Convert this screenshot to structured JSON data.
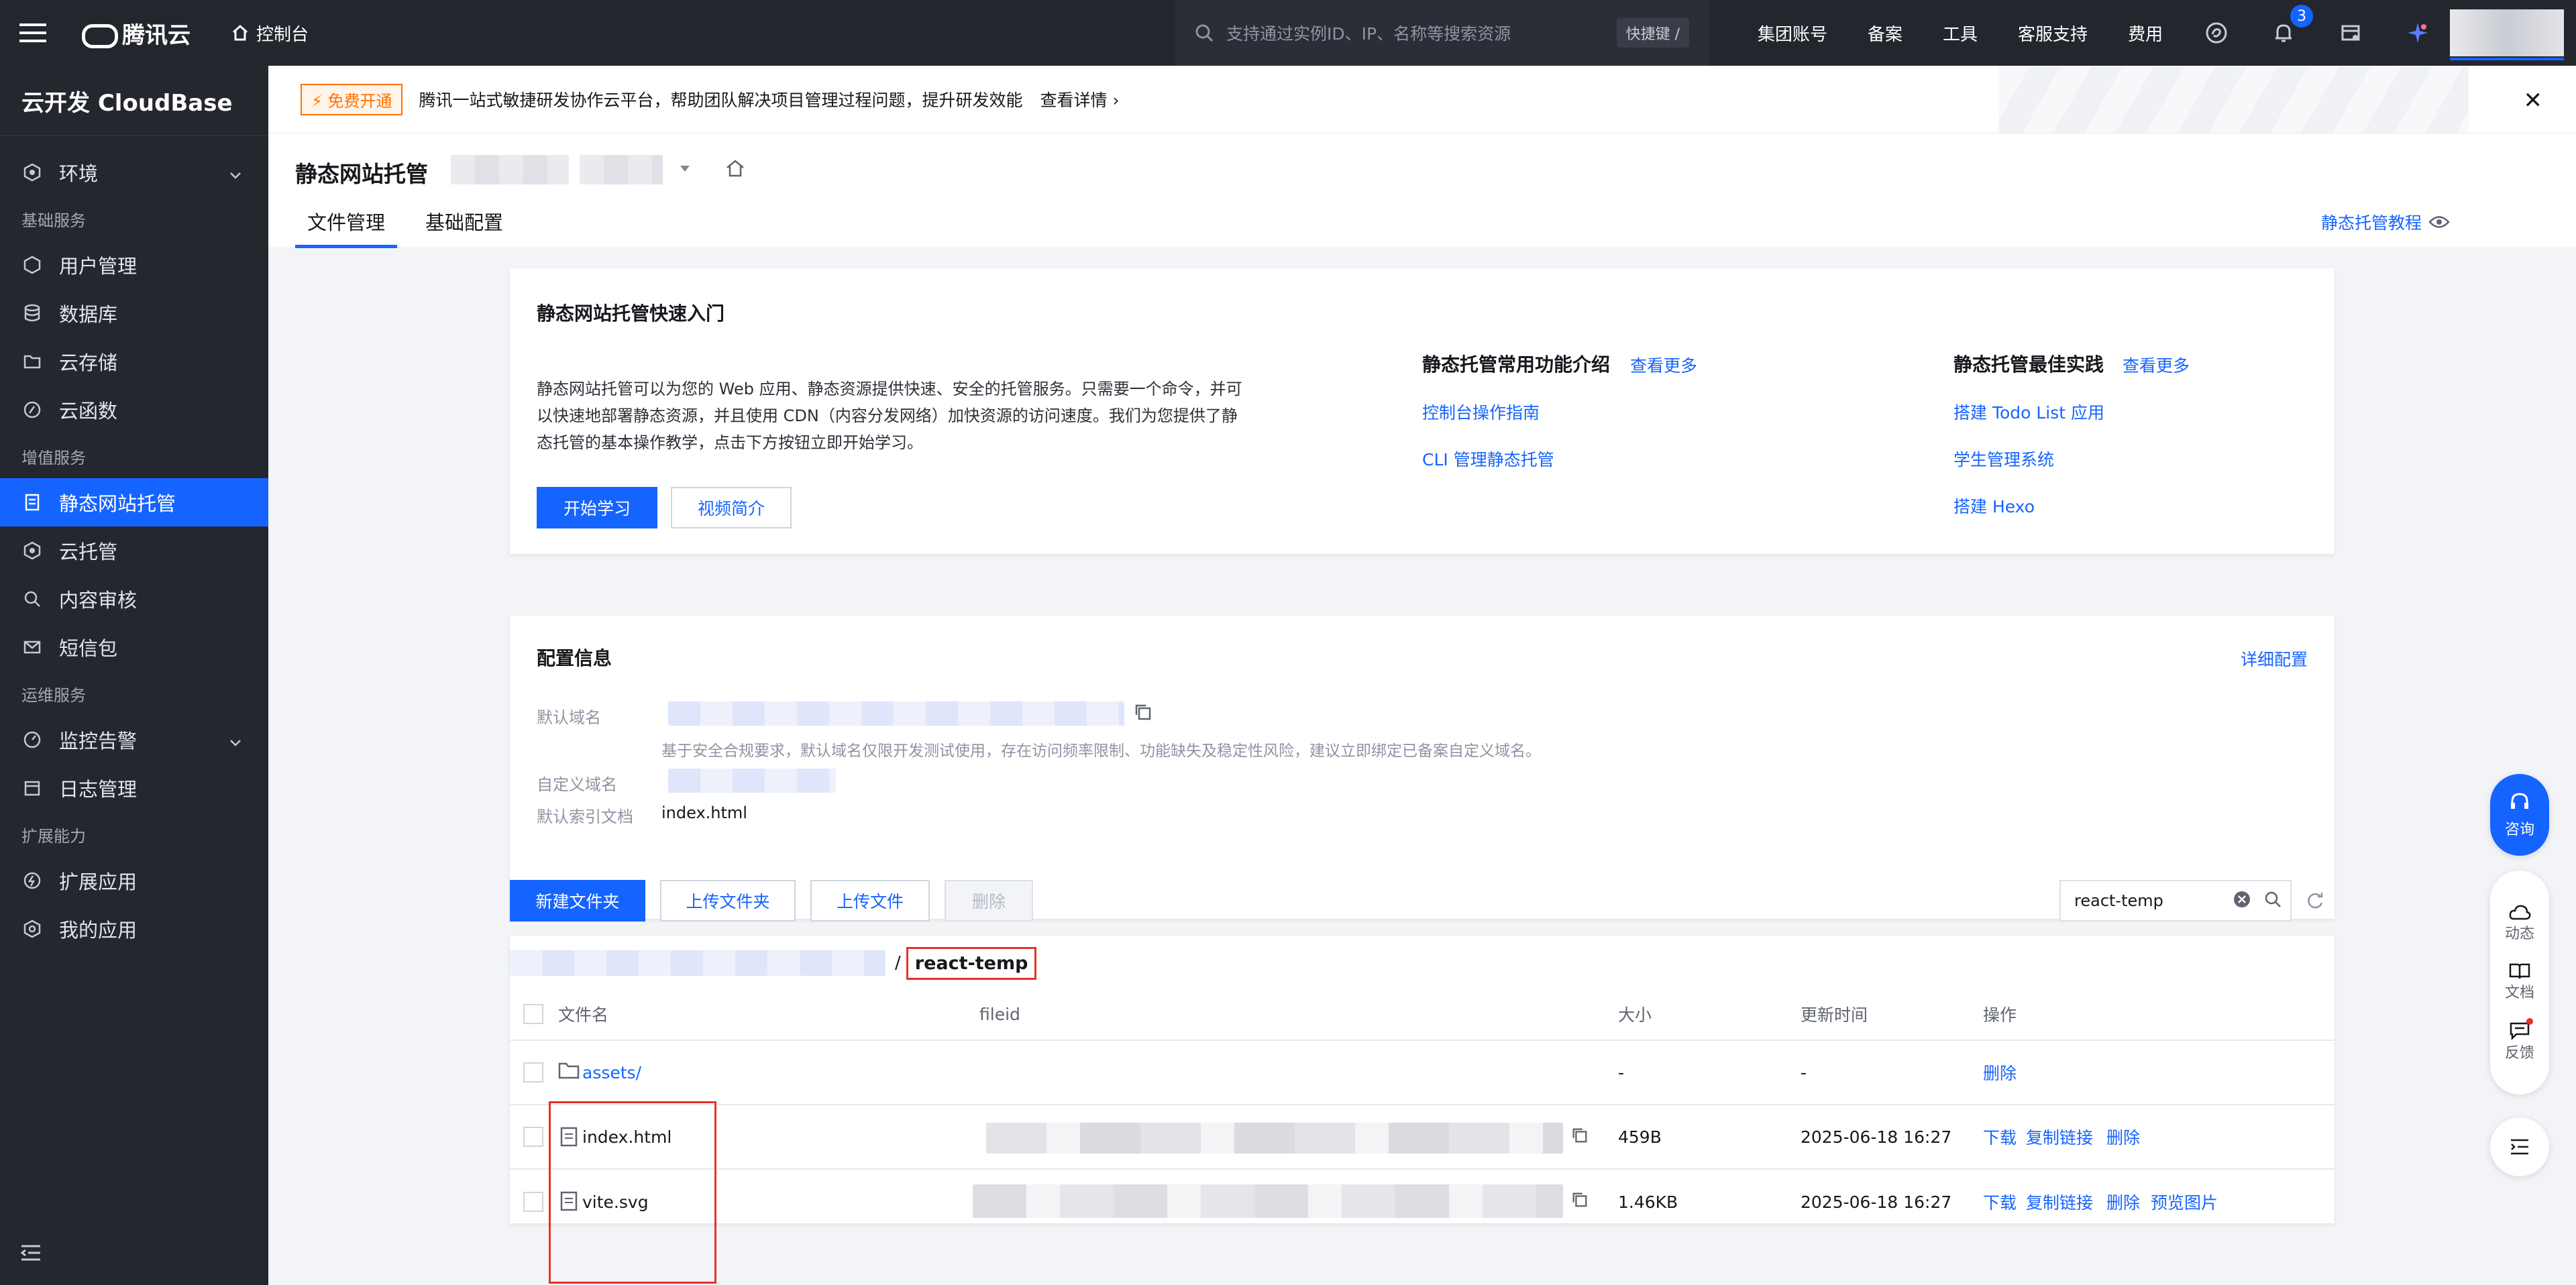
{
  "topbar": {
    "brand": "腾讯云",
    "console": "控制台",
    "search_placeholder": "支持通过实例ID、IP、名称等搜索资源",
    "shortcut": "快捷键 /",
    "links": [
      "集团账号",
      "备案",
      "工具",
      "客服支持",
      "费用"
    ],
    "notification_count": "3"
  },
  "sidebar": {
    "title": "云开发 CloudBase",
    "env_label": "环境",
    "groups": [
      {
        "label": "基础服务",
        "items": [
          "用户管理",
          "数据库",
          "云存储",
          "云函数"
        ]
      },
      {
        "label": "增值服务",
        "items": [
          "静态网站托管",
          "云托管",
          "内容审核",
          "短信包"
        ]
      },
      {
        "label": "运维服务",
        "items": [
          "监控告警",
          "日志管理"
        ]
      },
      {
        "label": "扩展能力",
        "items": [
          "扩展应用",
          "我的应用"
        ]
      }
    ]
  },
  "notice": {
    "tag": "免费开通",
    "text": "腾讯一站式敏捷研发协作云平台，帮助团队解决项目管理过程问题，提升研发效能",
    "detail": "查看详情"
  },
  "page": {
    "title": "静态网站托管",
    "tabs": [
      "文件管理",
      "基础配置"
    ],
    "tutorial": "静态托管教程"
  },
  "quickstart": {
    "title": "静态网站托管快速入门",
    "desc": "静态网站托管可以为您的 Web 应用、静态资源提供快速、安全的托管服务。只需要一个命令，并可以快速地部署静态资源，并且使用 CDN（内容分发网络）加快资源的访问速度。我们为您提供了静态托管的基本操作教学，点击下方按钮立即开始学习。",
    "start_btn": "开始学习",
    "video_btn": "视频简介",
    "features_title": "静态托管常用功能介绍",
    "features_more": "查看更多",
    "features": [
      "控制台操作指南",
      "CLI 管理静态托管"
    ],
    "practice_title": "静态托管最佳实践",
    "practice_more": "查看更多",
    "practices": [
      "搭建 Todo List 应用",
      "学生管理系统",
      "搭建 Hexo"
    ]
  },
  "config": {
    "title": "配置信息",
    "detail_link": "详细配置",
    "default_domain_label": "默认域名",
    "warning": "基于安全合规要求，默认域名仅限开发测试使用，存在访问频率限制、功能缺失及稳定性风险，建议立即绑定已备案自定义域名。",
    "custom_domain_label": "自定义域名",
    "index_label": "默认索引文档",
    "index_value": "index.html"
  },
  "files": {
    "new_folder": "新建文件夹",
    "upload_folder": "上传文件夹",
    "upload_file": "上传文件",
    "delete": "删除",
    "search_value": "react-temp",
    "path_sep": "/",
    "current_folder": "react-temp",
    "columns": [
      "文件名",
      "fileid",
      "大小",
      "更新时间",
      "操作"
    ],
    "rows": [
      {
        "name": "assets/",
        "type": "folder",
        "size": "-",
        "time": "-",
        "actions": [
          "删除"
        ]
      },
      {
        "name": "index.html",
        "type": "file",
        "size": "459B",
        "time": "2025-06-18 16:27",
        "actions": [
          "下载",
          "复制链接",
          "删除"
        ]
      },
      {
        "name": "vite.svg",
        "type": "file",
        "size": "1.46KB",
        "time": "2025-06-18 16:27",
        "actions": [
          "下载",
          "复制链接",
          "删除",
          "预览图片"
        ]
      }
    ]
  },
  "float": {
    "consult": "咨询",
    "dynamic": "动态",
    "docs": "文档",
    "feedback": "反馈"
  },
  "colors": {
    "accent": "#1664ff",
    "sidebar_bg": "#25272e",
    "topbar_bg": "#24262e",
    "highlight": "#e5322d",
    "tag": "#ff7200"
  }
}
